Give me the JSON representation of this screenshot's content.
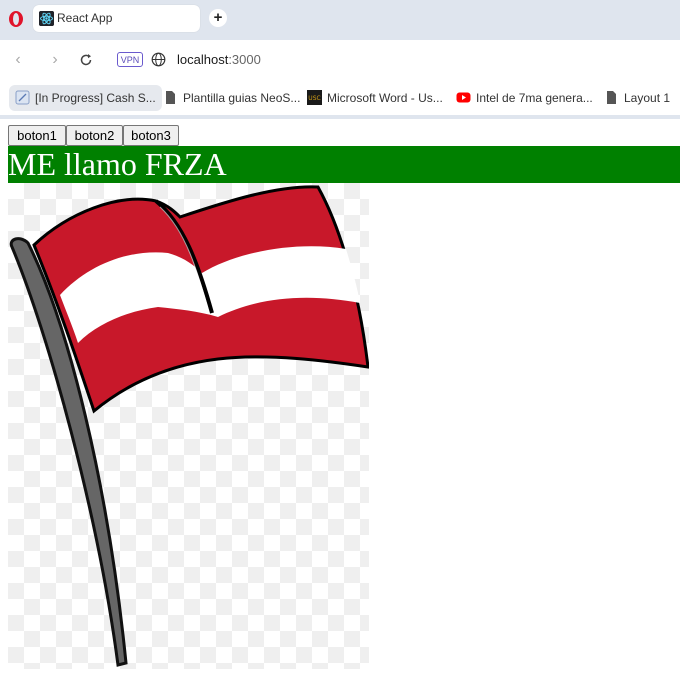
{
  "browser": {
    "tab": {
      "title": "React App",
      "icon": "react-icon"
    },
    "address": {
      "host": "localhost",
      "port": ":3000",
      "vpn_label": "VPN"
    },
    "bookmarks": [
      {
        "label": "[In Progress] Cash S...",
        "icon": "document-icon"
      },
      {
        "label": "Plantilla guias NeoS...",
        "icon": "file-icon"
      },
      {
        "label": "Microsoft Word - Us...",
        "icon": "usc-icon"
      },
      {
        "label": "Intel de 7ma genera...",
        "icon": "youtube-icon"
      },
      {
        "label": "Layout 1",
        "icon": "file-icon"
      }
    ]
  },
  "page": {
    "buttons": [
      "boton1",
      "boton2",
      "boton3"
    ],
    "heading": "ME llamo FRZA",
    "heading_bg": "#008000",
    "image": {
      "subject": "flag-illustration",
      "colors": [
        "#c8102e",
        "#ffffff"
      ]
    }
  }
}
